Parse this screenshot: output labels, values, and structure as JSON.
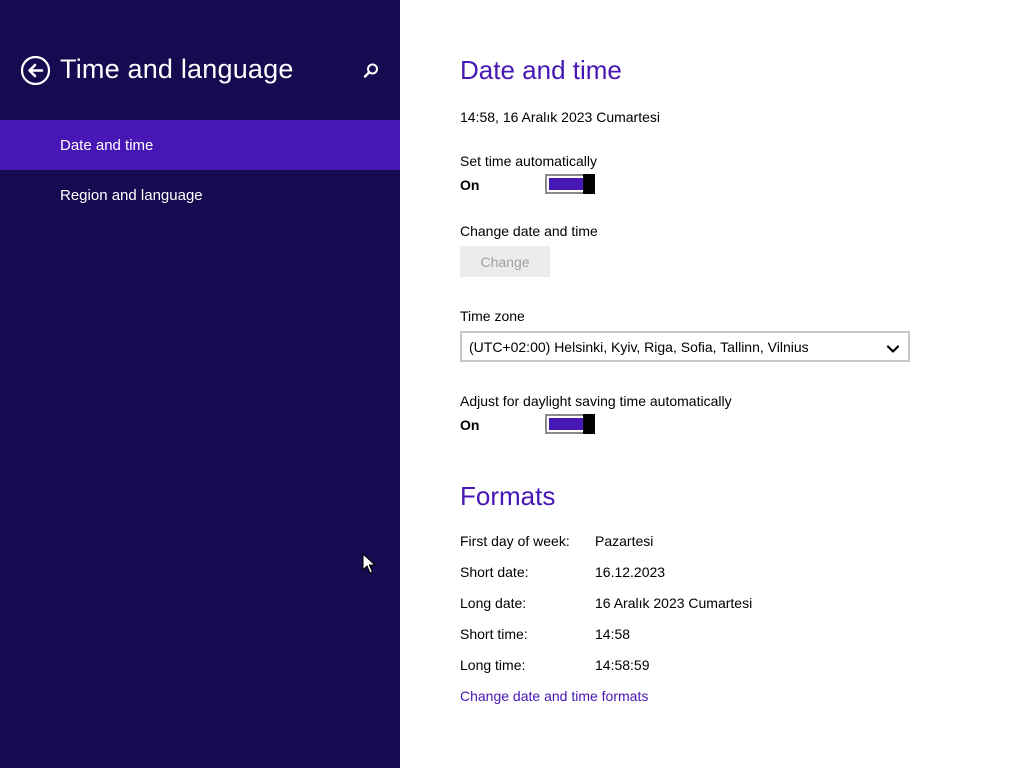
{
  "sidebar": {
    "title": "Time and language",
    "items": [
      {
        "label": "Date and time",
        "selected": true
      },
      {
        "label": "Region and language",
        "selected": false
      }
    ]
  },
  "date_time": {
    "title": "Date and time",
    "current": "14:58, 16 Aralık 2023 Cumartesi",
    "set_auto_label": "Set time automatically",
    "set_auto_state": "On",
    "change_label": "Change date and time",
    "change_button": "Change",
    "timezone_label": "Time zone",
    "timezone_value": "(UTC+02:00) Helsinki, Kyiv, Riga, Sofia, Tallinn, Vilnius",
    "dst_label": "Adjust for daylight saving time automatically",
    "dst_state": "On"
  },
  "formats": {
    "title": "Formats",
    "rows": [
      {
        "label": "First day of week:",
        "value": "Pazartesi"
      },
      {
        "label": "Short date:",
        "value": "16.12.2023"
      },
      {
        "label": "Long date:",
        "value": "16 Aralık 2023 Cumartesi"
      },
      {
        "label": "Short time:",
        "value": "14:58"
      },
      {
        "label": "Long time:",
        "value": "14:58:59"
      }
    ],
    "link": "Change date and time formats"
  },
  "colors": {
    "sidebar_bg": "#180a50",
    "accent": "#4617b4"
  },
  "icons": {
    "back": "back-arrow-circle-icon",
    "search": "search-icon",
    "dropdown": "chevron-down-icon",
    "cursor": "mouse-pointer-icon"
  }
}
